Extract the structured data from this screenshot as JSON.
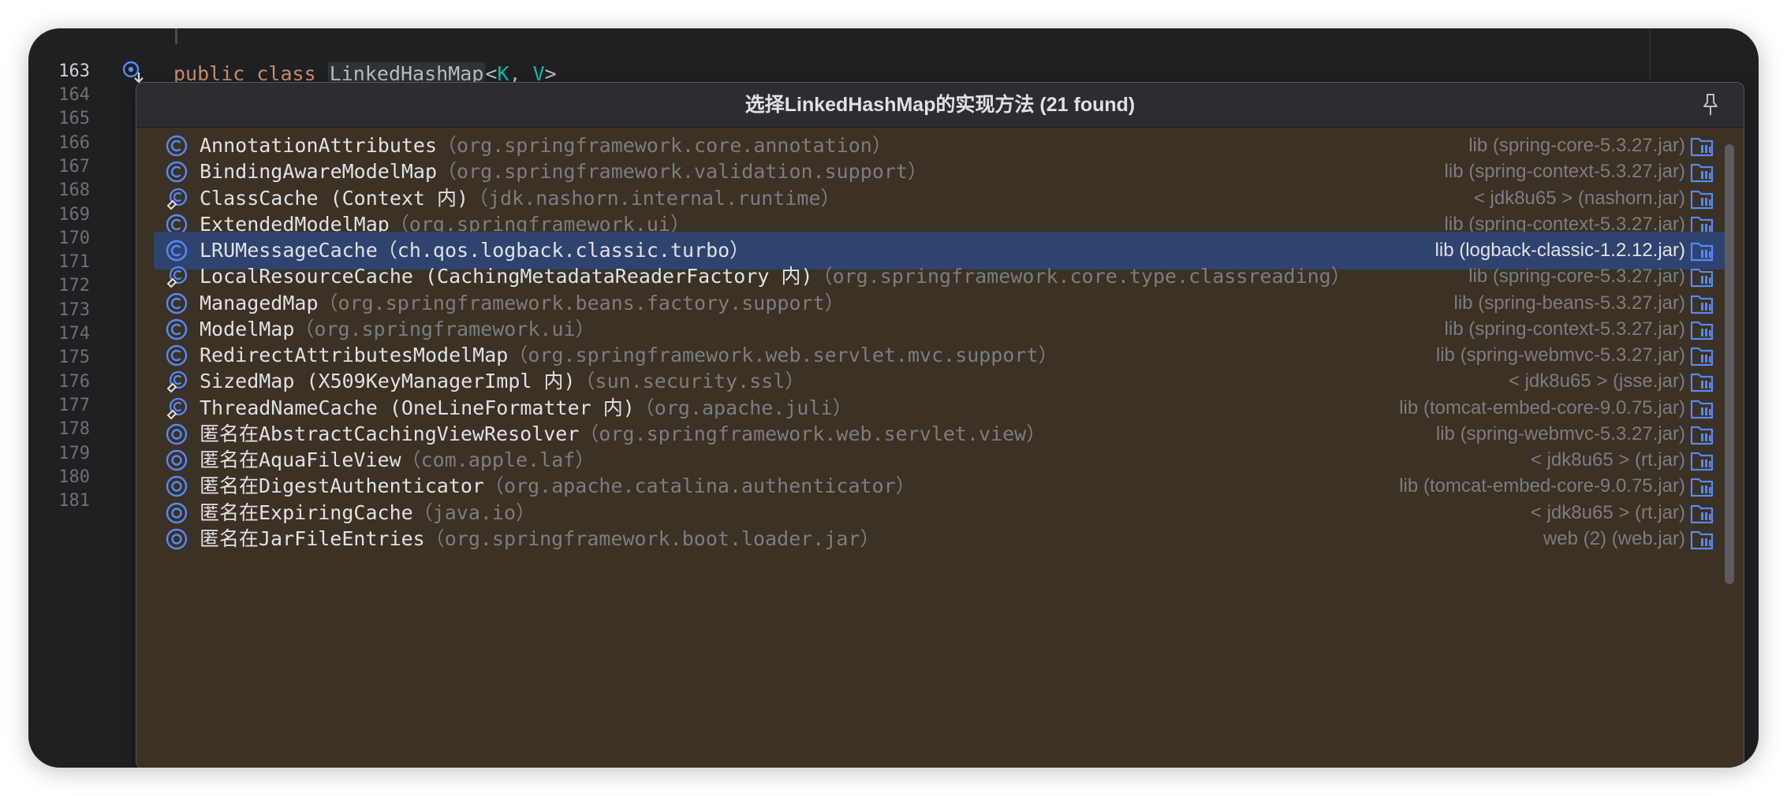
{
  "editor": {
    "line_numbers": [
      "163",
      "164",
      "165",
      "166",
      "167",
      "168",
      "169",
      "170",
      "171",
      "172",
      "173",
      "174",
      "175",
      "176",
      "177",
      "178",
      "179",
      "180",
      "181"
    ],
    "code": {
      "kw1": "public",
      "kw2": "class",
      "class_name": "LinkedHashMap",
      "lt": "<",
      "type1": "K",
      "comma": ", ",
      "type2": "V",
      "gt": ">"
    }
  },
  "popup": {
    "title": "选择LinkedHashMap的实现方法 (21 found)",
    "items": [
      {
        "icon": "class-icon",
        "name": "AnnotationAttributes",
        "pkg": "（org.springframework.core.annotation）",
        "lib": "lib (spring-core-5.3.27.jar)"
      },
      {
        "icon": "class-icon",
        "name": "BindingAwareModelMap",
        "pkg": "（org.springframework.validation.support）",
        "lib": "lib (spring-context-5.3.27.jar)"
      },
      {
        "icon": "inner-class-icon",
        "name": "ClassCache (Context 内)",
        "pkg": "（jdk.nashorn.internal.runtime）",
        "lib": "< jdk8u65 > (nashorn.jar)"
      },
      {
        "icon": "class-icon",
        "name": "ExtendedModelMap",
        "pkg": "（org.springframework.ui）",
        "lib": "lib (spring-context-5.3.27.jar)"
      },
      {
        "icon": "class-icon",
        "name": "LRUMessageCache",
        "pkg": "（ch.qos.logback.classic.turbo）",
        "lib": "lib (logback-classic-1.2.12.jar)",
        "selected": true
      },
      {
        "icon": "inner-class-icon",
        "name": "LocalResourceCache (CachingMetadataReaderFactory 内)",
        "pkg": "（org.springframework.core.type.classreading）",
        "lib": "lib (spring-core-5.3.27.jar)"
      },
      {
        "icon": "class-icon",
        "name": "ManagedMap",
        "pkg": "（org.springframework.beans.factory.support）",
        "lib": "lib (spring-beans-5.3.27.jar)"
      },
      {
        "icon": "class-icon",
        "name": "ModelMap",
        "pkg": "（org.springframework.ui）",
        "lib": "lib (spring-context-5.3.27.jar)"
      },
      {
        "icon": "class-icon",
        "name": "RedirectAttributesModelMap",
        "pkg": "（org.springframework.web.servlet.mvc.support）",
        "lib": "lib (spring-webmvc-5.3.27.jar)"
      },
      {
        "icon": "inner-class-icon",
        "name": "SizedMap (X509KeyManagerImpl 内)",
        "pkg": "（sun.security.ssl）",
        "lib": "< jdk8u65 > (jsse.jar)"
      },
      {
        "icon": "inner-class-icon",
        "name": "ThreadNameCache (OneLineFormatter 内)",
        "pkg": "（org.apache.juli）",
        "lib": "lib (tomcat-embed-core-9.0.75.jar)"
      },
      {
        "icon": "anonymous-class-icon",
        "name": "匿名在AbstractCachingViewResolver",
        "pkg": "（org.springframework.web.servlet.view）",
        "lib": "lib (spring-webmvc-5.3.27.jar)"
      },
      {
        "icon": "anonymous-class-icon",
        "name": "匿名在AquaFileView",
        "pkg": "（com.apple.laf）",
        "lib": "< jdk8u65 > (rt.jar)"
      },
      {
        "icon": "anonymous-class-icon",
        "name": "匿名在DigestAuthenticator",
        "pkg": "（org.apache.catalina.authenticator）",
        "lib": "lib (tomcat-embed-core-9.0.75.jar)"
      },
      {
        "icon": "anonymous-class-icon",
        "name": "匿名在ExpiringCache",
        "pkg": "（java.io）",
        "lib": "< jdk8u65 > (rt.jar)"
      },
      {
        "icon": "anonymous-class-icon",
        "name": "匿名在JarFileEntries",
        "pkg": "（org.springframework.boot.loader.jar）",
        "lib": "web (2) (web.jar)"
      }
    ]
  },
  "colors": {
    "editor_bg": "#1f2022",
    "popup_bg": "#3b3124",
    "selection": "#2e436e",
    "keyword": "#cf8e6d",
    "type_param": "#16baac",
    "icon_blue": "#548af7"
  }
}
